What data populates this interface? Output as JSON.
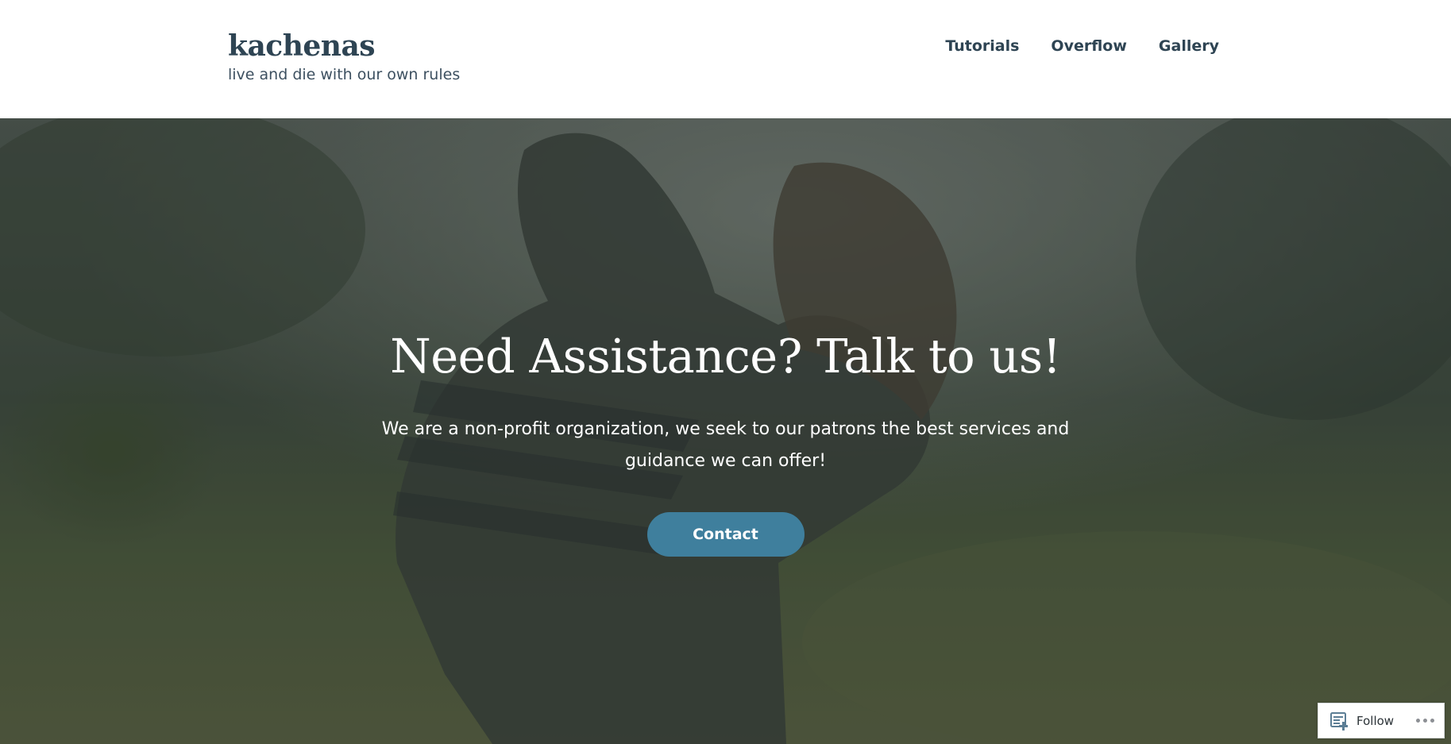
{
  "site": {
    "title": "kachenas",
    "tagline": "live and die with our own rules"
  },
  "nav": {
    "items": [
      {
        "label": "Tutorials"
      },
      {
        "label": "Overflow"
      },
      {
        "label": "Gallery"
      }
    ]
  },
  "hero": {
    "heading": "Need Assistance? Talk to us!",
    "text": "We are a non-profit organization, we seek to our patrons the best services and guidance we can offer!",
    "button_label": "Contact",
    "button_color": "#3f7f9d",
    "background_description_icon": "photo-icon"
  },
  "follow_widget": {
    "label": "Follow",
    "icon": "follow-reader-icon",
    "more_icon": "ellipsis-icon"
  },
  "colors": {
    "text_dark": "#2e4453",
    "hero_overlay": "#46503f"
  }
}
